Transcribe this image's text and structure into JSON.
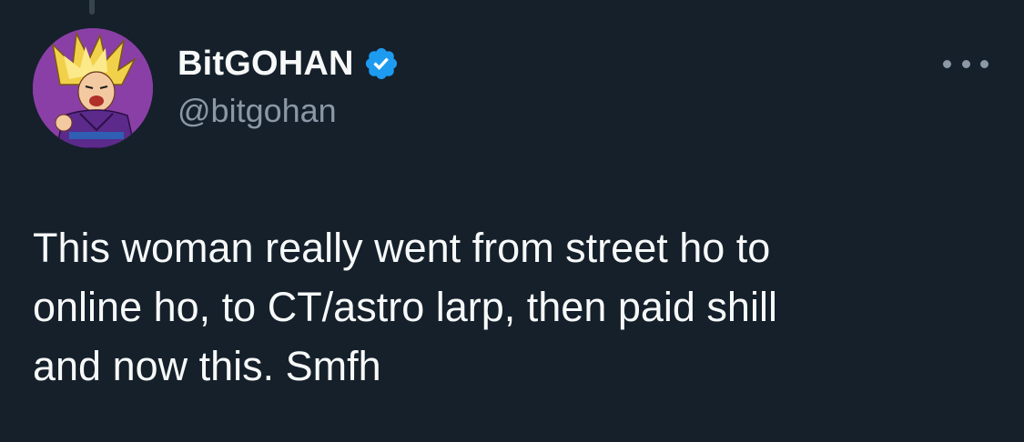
{
  "author": {
    "display_name": "BitGOHAN",
    "handle": "@bitgohan",
    "verified": true,
    "avatar_icon": "anime-character-avatar"
  },
  "tweet": {
    "lines": [
      "This woman really went from street ho to",
      "online ho, to CT/astro larp, then paid shill",
      "and now this. Smfh"
    ]
  },
  "icons": {
    "more": "more-options-icon",
    "verified": "verified-badge-icon"
  },
  "colors": {
    "background": "#15202b",
    "text_primary": "#f7f9f9",
    "text_secondary": "#8b98a5",
    "verified_blue": "#1d9bf0",
    "avatar_bg": "#8a3fa6"
  }
}
